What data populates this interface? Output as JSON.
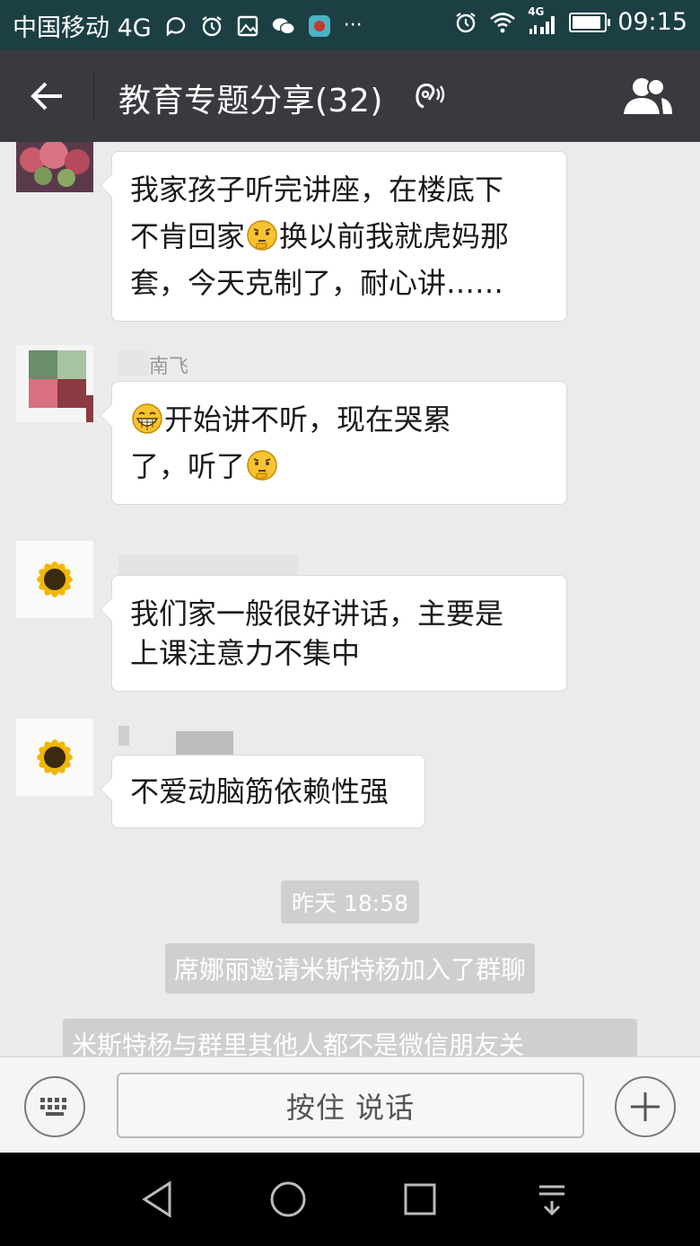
{
  "status_bar": {
    "carrier": "中国移动 4G",
    "network": "4G",
    "time": "09:15",
    "battery_level": 0.9,
    "icons": [
      "message-icon",
      "alarm-icon",
      "gallery-icon",
      "wechat-icon",
      "huawei-app-icon",
      "more-icon",
      "alarm-icon",
      "wifi-icon",
      "signal-icon",
      "battery-icon"
    ]
  },
  "header": {
    "back_icon": "arrow-left-icon",
    "title": "教育专题分享(32)",
    "earpiece_icon": "earpiece-mode-icon",
    "members_icon": "group-members-icon"
  },
  "messages": [
    {
      "avatar": "succulent-avatar",
      "name": "",
      "lines": [
        [
          {
            "t": "我家孩子听完讲座，在楼底下"
          }
        ],
        [
          {
            "t": "不肯回家"
          },
          {
            "e": "thinking-emoji"
          },
          {
            "t": "换以前我就虎妈那"
          }
        ],
        [
          {
            "t": "套，今天克制了，耐心讲……"
          }
        ]
      ]
    },
    {
      "avatar": "pixelated-avatar",
      "name": "南飞",
      "lines": [
        [
          {
            "e": "grin-emoji"
          },
          {
            "t": "开始讲不听，现在哭累"
          }
        ],
        [
          {
            "t": "了，听了"
          },
          {
            "e": "thinking-emoji"
          }
        ]
      ]
    },
    {
      "avatar": "sunflower-avatar",
      "name": "",
      "lines": [
        [
          {
            "t": "我们家一般很好讲话，主要是"
          }
        ],
        [
          {
            "t": "上课注意力不集中"
          }
        ]
      ]
    },
    {
      "avatar": "sunflower-avatar",
      "name": "",
      "lines": [
        [
          {
            "t": "不爱动脑筋依赖性强"
          }
        ]
      ]
    }
  ],
  "system": {
    "timestamp": "昨天 18:58",
    "invite_notice": "席娜丽邀请米斯特杨加入了群聊",
    "friend_notice": "米斯特杨与群里其他人都不是微信朋友关"
  },
  "input_bar": {
    "keyboard_icon": "keyboard-icon",
    "hold_to_talk": "按住 说话",
    "plus_icon": "plus-circle-icon"
  },
  "nav_bar": {
    "icons": [
      "nav-back-icon",
      "nav-home-icon",
      "nav-recents-icon",
      "nav-notification-icon"
    ]
  }
}
